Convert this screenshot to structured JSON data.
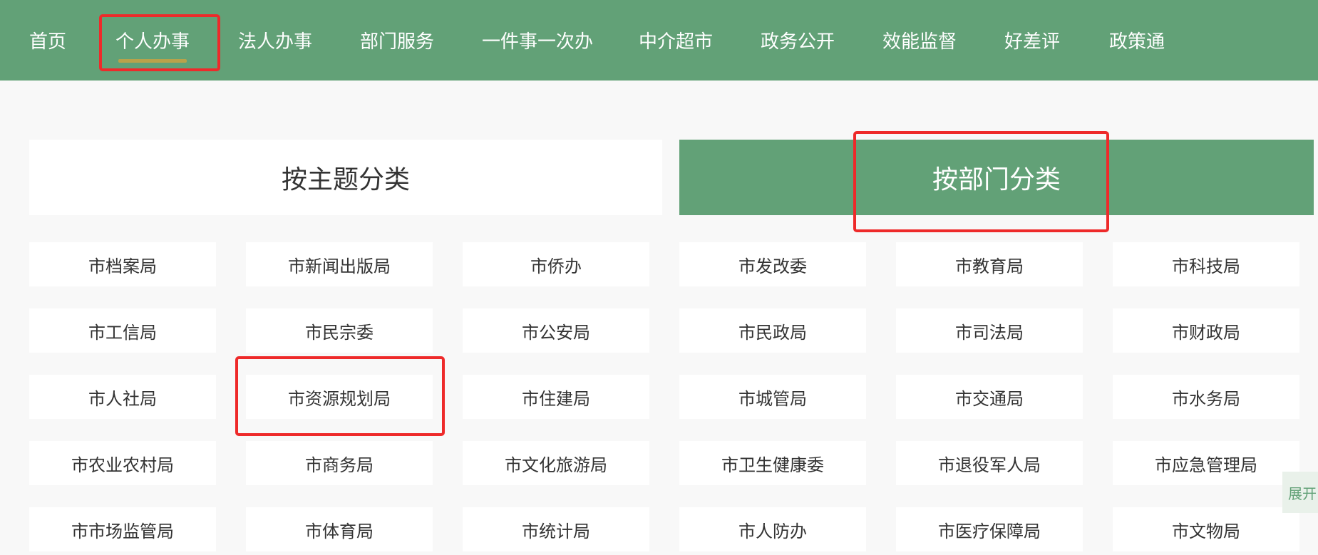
{
  "nav": {
    "items": [
      {
        "label": "首页"
      },
      {
        "label": "个人办事"
      },
      {
        "label": "法人办事"
      },
      {
        "label": "部门服务"
      },
      {
        "label": "一件事一次办"
      },
      {
        "label": "中介超市"
      },
      {
        "label": "政务公开"
      },
      {
        "label": "效能监督"
      },
      {
        "label": "好差评"
      },
      {
        "label": "政策通"
      }
    ],
    "active": "个人办事"
  },
  "tabs": {
    "by_topic": "按主题分类",
    "by_department": "按部门分类",
    "active": "按部门分类"
  },
  "departments": [
    "市档案局",
    "市新闻出版局",
    "市侨办",
    "市发改委",
    "市教育局",
    "市科技局",
    "市工信局",
    "市民宗委",
    "市公安局",
    "市民政局",
    "市司法局",
    "市财政局",
    "市人社局",
    "市资源规划局",
    "市住建局",
    "市城管局",
    "市交通局",
    "市水务局",
    "市农业农村局",
    "市商务局",
    "市文化旅游局",
    "市卫生健康委",
    "市退役军人局",
    "市应急管理局",
    "市市场监管局",
    "市体育局",
    "市统计局",
    "市人防办",
    "市医疗保障局",
    "市文物局"
  ],
  "expand_label": "展开",
  "colors": {
    "accent_green": "#62a177",
    "underline_gold": "#b9a24a",
    "highlight_red": "#ee2a2a",
    "page_bg": "#f8f8f8"
  }
}
